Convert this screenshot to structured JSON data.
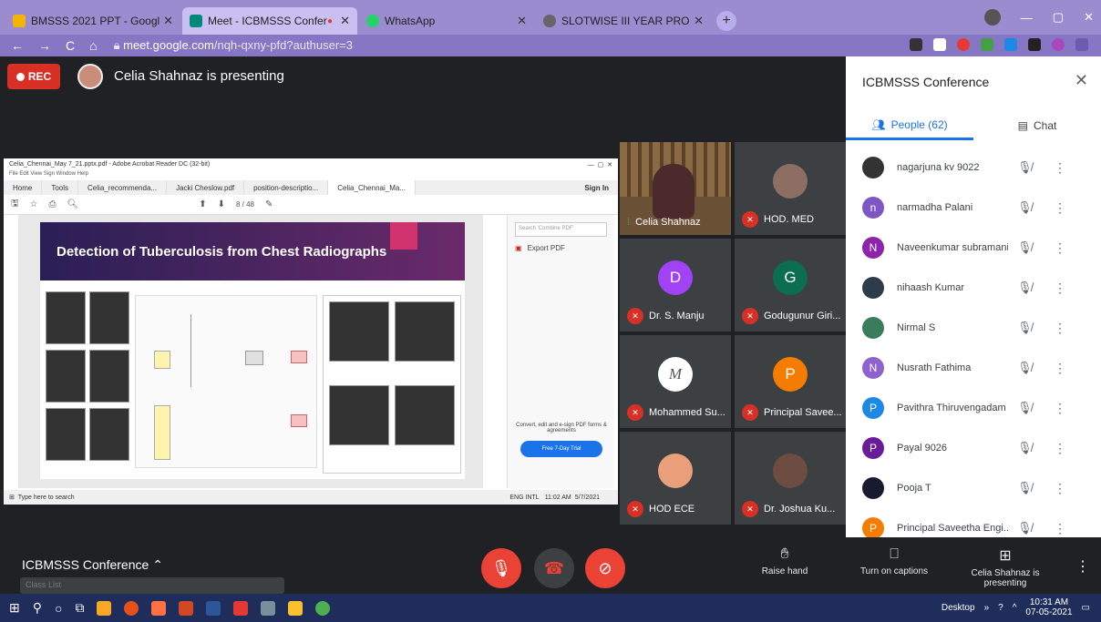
{
  "browser": {
    "tabs": [
      {
        "title": "BMSSS 2021 PPT - Google Slides",
        "color": "#f4b400"
      },
      {
        "title": "Meet - ICBMSSS Conference",
        "color": "#00897b",
        "active": true
      },
      {
        "title": "WhatsApp",
        "color": "#25d366"
      },
      {
        "title": "SLOTWISE III YEAR PROFORMA",
        "color": "#555555"
      }
    ],
    "url_host": "meet.google.com",
    "url_path": "/nqh-qxny-pfd?authuser=3"
  },
  "stage": {
    "rec_label": "REC",
    "presenting_text": "Celia Shahnaz is presenting"
  },
  "shared_screen": {
    "window_title": "Celia_Chennai_May 7_21.pptx.pdf - Adobe Acrobat Reader DC (32-bit)",
    "menu": "File  Edit  View  Sign  Window  Help",
    "tabs": [
      "Home",
      "Tools",
      "Celia_recommenda...",
      "Jacki Cheslow.pdf",
      "position-descriptio...",
      "Celia_Chennai_Ma..."
    ],
    "sign_in": "Sign In",
    "page_indicator": "8 / 48",
    "slide_title": "Detection of Tuberculosis from Chest Radiographs",
    "search_placeholder": "Search 'Combine PDF'",
    "export_pdf": "Export PDF",
    "convert_text": "Convert, edit and e-sign PDF forms & agreements",
    "trial_button": "Free 7-Day Trial",
    "taskbar_search": "Type here to search",
    "tray_lang": "ENG INTL",
    "tray_time": "11:02 AM",
    "tray_date": "5/7/2021"
  },
  "tiles": [
    {
      "name": "Celia Shahnaz",
      "muted": false
    },
    {
      "name": "HOD. MED",
      "muted": true
    },
    {
      "name": "Dr. S. Manju",
      "muted": true,
      "initial": "D",
      "color": "#a142f4"
    },
    {
      "name": "Godugunur Giri...",
      "muted": true,
      "initial": "G",
      "color": "#0b6e4f"
    },
    {
      "name": "Mohammed Su...",
      "muted": true
    },
    {
      "name": "Principal Savee...",
      "muted": true,
      "initial": "P",
      "color": "#f57c00"
    },
    {
      "name": "HOD ECE",
      "muted": true
    },
    {
      "name": "Dr. Joshua Ku...",
      "muted": true
    }
  ],
  "panel": {
    "title": "ICBMSSS Conference",
    "people_tab": "People (62)",
    "chat_tab": "Chat",
    "people": [
      {
        "name": "nagarjuna kv 9022",
        "initial": "",
        "color": "#333333"
      },
      {
        "name": "narmadha Palani",
        "initial": "n",
        "color": "#7e57c2"
      },
      {
        "name": "Naveenkumar subramani",
        "initial": "N",
        "color": "#8e24aa"
      },
      {
        "name": "nihaash Kumar",
        "initial": "",
        "color": "#2d3b4a"
      },
      {
        "name": "Nirmal S",
        "initial": "",
        "color": "#3a7d5c"
      },
      {
        "name": "Nusrath Fathima",
        "initial": "N",
        "color": "#8e63ce"
      },
      {
        "name": "Pavithra Thiruvengadam",
        "initial": "P",
        "color": "#1e88e5"
      },
      {
        "name": "Payal 9026",
        "initial": "P",
        "color": "#6a1b9a"
      },
      {
        "name": "Pooja T",
        "initial": "",
        "color": "#1a1a2e"
      },
      {
        "name": "Principal Saveetha Engi...",
        "initial": "P",
        "color": "#f57c00"
      }
    ]
  },
  "bottom_bar": {
    "meeting_name": "ICBMSSS Conference",
    "ghost_text": "Class List",
    "raise_hand": "Raise hand",
    "captions": "Turn on captions",
    "presenting": "Celia Shahnaz is presenting"
  },
  "windows_taskbar": {
    "desktop_label": "Desktop",
    "time": "10:31 AM",
    "date": "07-05-2021"
  }
}
